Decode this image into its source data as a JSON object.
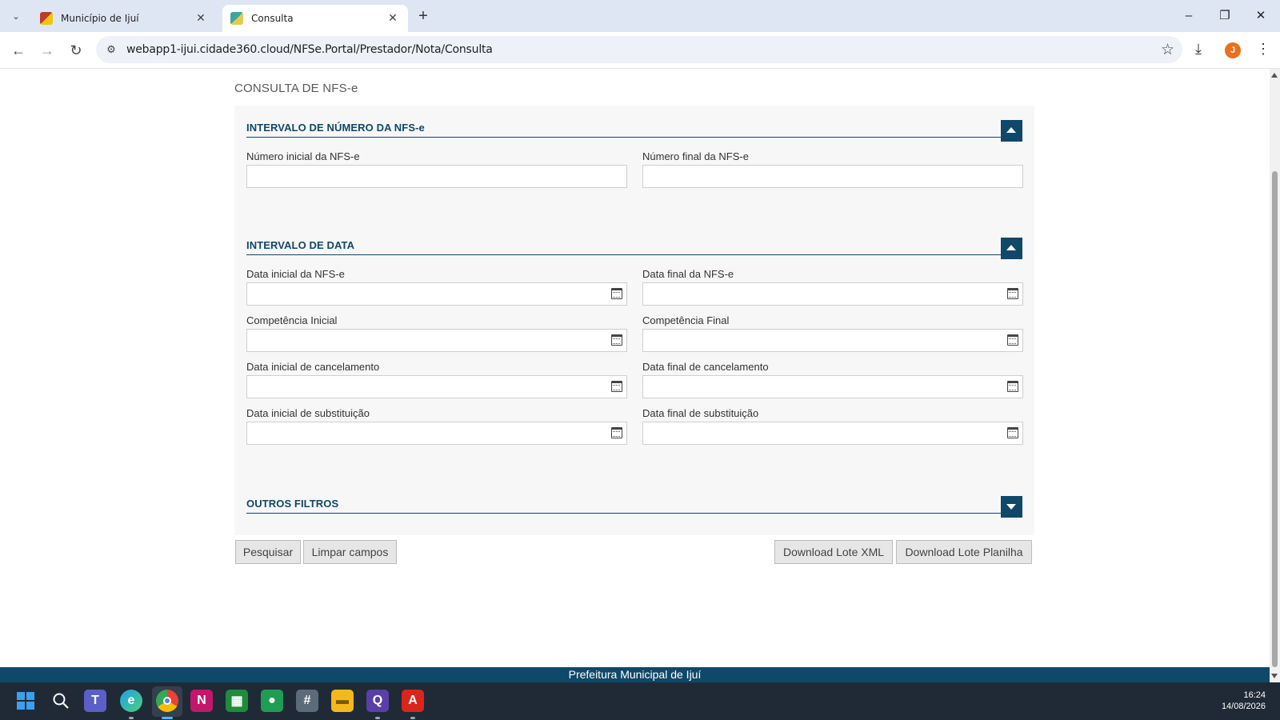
{
  "browser": {
    "tabs": [
      {
        "title": "Município de Ijuí",
        "active": false
      },
      {
        "title": "Consulta",
        "active": true
      }
    ],
    "url": "webapp1-ijui.cidade360.cloud/NFSe.Portal/Prestador/Nota/Consulta",
    "avatar_letter": "J"
  },
  "page": {
    "title": "CONSULTA DE NFS-e",
    "sections": {
      "numero": {
        "header": "INTERVALO DE NÚMERO DA NFS-e",
        "expanded": true,
        "fields": {
          "numero_inicial": {
            "label": "Número inicial da NFS-e",
            "value": ""
          },
          "numero_final": {
            "label": "Número final da NFS-e",
            "value": ""
          }
        }
      },
      "data": {
        "header": "INTERVALO DE DATA",
        "expanded": true,
        "fields": {
          "data_inicial": {
            "label": "Data inicial da NFS-e",
            "value": ""
          },
          "data_final": {
            "label": "Data final da NFS-e",
            "value": ""
          },
          "competencia_inicial": {
            "label": "Competência Inicial",
            "value": ""
          },
          "competencia_final": {
            "label": "Competência Final",
            "value": ""
          },
          "cancel_inicial": {
            "label": "Data inicial de cancelamento",
            "value": ""
          },
          "cancel_final": {
            "label": "Data final de cancelamento",
            "value": ""
          },
          "subst_inicial": {
            "label": "Data inicial de substituição",
            "value": ""
          },
          "subst_final": {
            "label": "Data final de substituição",
            "value": ""
          }
        }
      },
      "outros": {
        "header": "OUTROS FILTROS",
        "expanded": false
      }
    },
    "buttons": {
      "pesquisar": "Pesquisar",
      "limpar": "Limpar campos",
      "download_xml": "Download Lote XML",
      "download_planilha": "Download Lote Planilha"
    },
    "footer": "Prefeitura Municipal de Ijuí"
  },
  "taskbar": {
    "time": "16:24",
    "date": "14/08/2026"
  },
  "colors": {
    "brand": "#0f4869",
    "panel_bg": "#f7f7f7",
    "button_bg": "#e6e6e6"
  }
}
